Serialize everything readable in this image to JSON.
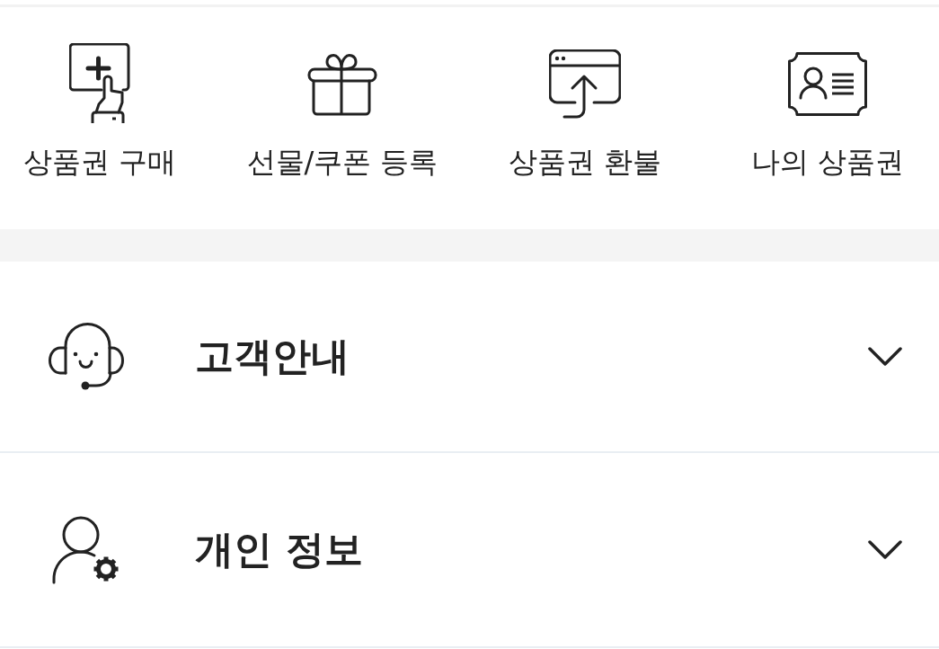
{
  "quick_menu": [
    {
      "label": "상품권 구매"
    },
    {
      "label": "선물/쿠폰 등록"
    },
    {
      "label": "상품권 환불"
    },
    {
      "label": "나의 상품권"
    }
  ],
  "sections": [
    {
      "title": "고객안내",
      "expanded": false
    },
    {
      "title": "개인 정보",
      "expanded": false
    }
  ]
}
